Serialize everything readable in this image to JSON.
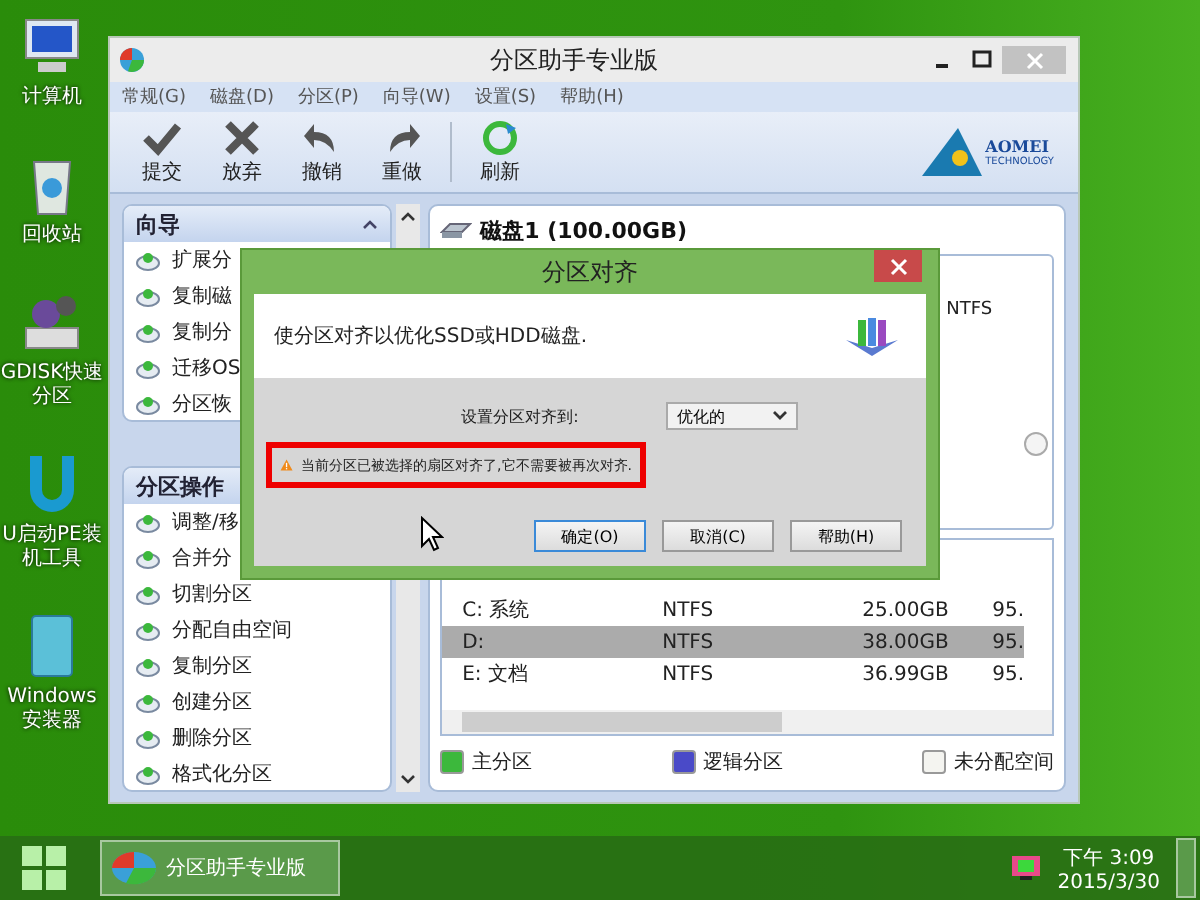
{
  "desktop_icons": [
    {
      "label": "计算机",
      "kind": "computer"
    },
    {
      "label": "回收站",
      "kind": "recycle"
    },
    {
      "label": "GDISK快速分区",
      "kind": "gears"
    },
    {
      "label": "U启动PE装机工具",
      "kind": "u"
    },
    {
      "label": "Windows安装器",
      "kind": "installer"
    }
  ],
  "window": {
    "title": "分区助手专业版"
  },
  "menu": [
    "常规(G)",
    "磁盘(D)",
    "分区(P)",
    "向导(W)",
    "设置(S)",
    "帮助(H)"
  ],
  "toolbar": [
    {
      "label": "提交",
      "kind": "check"
    },
    {
      "label": "放弃",
      "kind": "cross"
    },
    {
      "label": "撤销",
      "kind": "undo"
    },
    {
      "label": "重做",
      "kind": "redo"
    },
    {
      "label": "刷新",
      "kind": "refresh"
    }
  ],
  "logo": {
    "name": "AOMEI",
    "subtitle": "TECHNOLOGY"
  },
  "sidebar": {
    "sections": [
      {
        "title": "向导",
        "items": [
          "扩展分",
          "复制磁",
          "复制分",
          "迁移OS",
          "分区恢"
        ]
      },
      {
        "title": "分区操作",
        "items": [
          "调整/移",
          "合并分",
          "切割分区",
          "分配自由空间",
          "复制分区",
          "创建分区",
          "删除分区",
          "格式化分区"
        ]
      }
    ]
  },
  "disk": {
    "title": "磁盘1 (100.00GB)",
    "map_label": "NTFS",
    "partitions": [
      {
        "name": "C: 系统",
        "fs": "NTFS",
        "size": "25.00GB",
        "column_4": "95.",
        "selected": false
      },
      {
        "name": "D:",
        "fs": "NTFS",
        "size": "38.00GB",
        "column_4": "95.",
        "selected": true
      },
      {
        "name": "E: 文档",
        "fs": "NTFS",
        "size": "36.99GB",
        "column_4": "95.",
        "selected": false
      }
    ]
  },
  "legend": [
    {
      "label": "主分区",
      "color": "#3cb83c"
    },
    {
      "label": "逻辑分区",
      "color": "#4a4ac8"
    },
    {
      "label": "未分配空间",
      "color": "#f4f4f0"
    }
  ],
  "dialog": {
    "title": "分区对齐",
    "description": "使分区对齐以优化SSD或HDD磁盘.",
    "field_label": "设置分区对齐到:",
    "select_value": "优化的",
    "warning": "当前分区已被选择的扇区对齐了,它不需要被再次对齐.",
    "buttons": [
      "确定(O)",
      "取消(C)",
      "帮助(H)"
    ]
  },
  "taskbar": {
    "app": "分区助手专业版",
    "time": "下午 3:09",
    "date": "2015/3/30"
  }
}
